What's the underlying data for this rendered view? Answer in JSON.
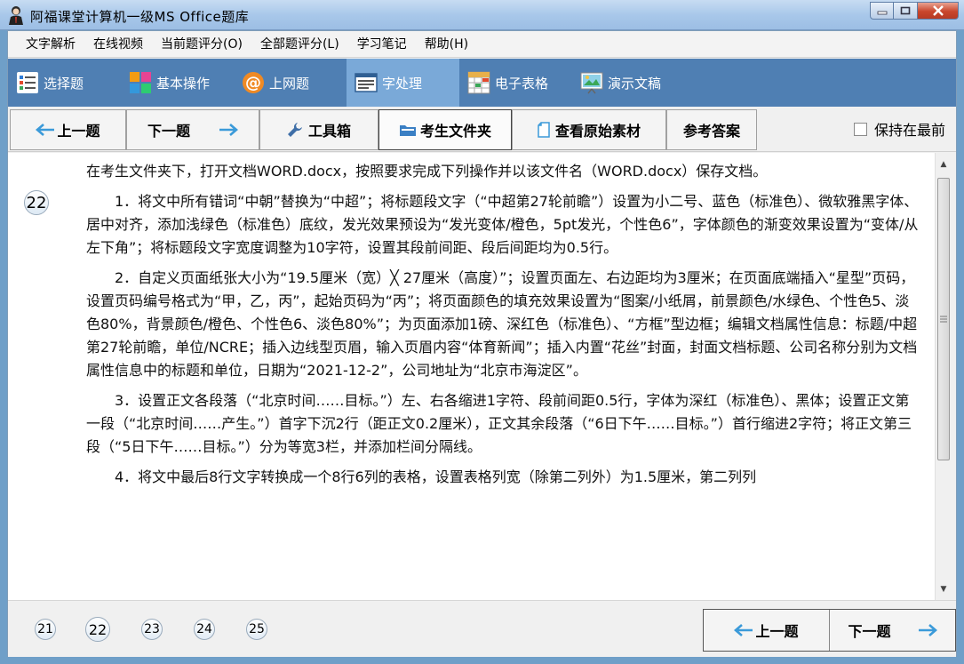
{
  "window": {
    "title": "阿福课堂计算机一级MS Office题库"
  },
  "menu": [
    "文字解析",
    "在线视频",
    "当前题评分(O)",
    "全部题评分(L)",
    "学习笔记",
    "帮助(H)"
  ],
  "categories": [
    {
      "label": "选择题",
      "icon": "list-icon"
    },
    {
      "label": "基本操作",
      "icon": "grid-icon"
    },
    {
      "label": "上网题",
      "icon": "at-sign-icon"
    },
    {
      "label": "字处理",
      "icon": "document-icon"
    },
    {
      "label": "电子表格",
      "icon": "spreadsheet-icon"
    },
    {
      "label": "演示文稿",
      "icon": "presentation-icon"
    }
  ],
  "toolbar": {
    "prev": "上一题",
    "next": "下一题",
    "tools": "工具箱",
    "folder": "考生文件夹",
    "source": "查看原始素材",
    "answer": "参考答案",
    "keep_on_top": "保持在最前"
  },
  "question": {
    "number": "22",
    "intro": "在考生文件夹下，打开文档WORD.docx，按照要求完成下列操作并以该文件名（WORD.docx）保存文档。",
    "p1": "1．将文中所有错词“中朝”替换为“中超”；将标题段文字（“中超第27轮前瞻”）设置为小二号、蓝色（标准色）、微软雅黑字体、居中对齐，添加浅绿色（标准色）底纹，发光效果预设为“发光变体/橙色，5pt发光，个性色6”，字体颜色的渐变效果设置为“变体/从左下角”；将标题段文字宽度调整为10字符，设置其段前间距、段后间距均为0.5行。",
    "p2": "2．自定义页面纸张大小为“19.5厘米（宽）╳ 27厘米（高度）”；设置页面左、右边距均为3厘米；在页面底端插入“星型”页码，设置页码编号格式为“甲，乙，丙”，起始页码为“丙”；将页面颜色的填充效果设置为“图案/小纸屑，前景颜色/水绿色、个性色5、淡色80%，背景颜色/橙色、个性色6、淡色80%”；为页面添加1磅、深红色（标准色）、“方框”型边框；编辑文档属性信息：标题/中超第27轮前瞻，单位/NCRE；插入边线型页眉，输入页眉内容“体育新闻”；插入内置“花丝”封面，封面文档标题、公司名称分别为文档属性信息中的标题和单位，日期为“2021-12-2”，公司地址为“北京市海淀区”。",
    "p3": "3．设置正文各段落（“北京时间……目标。”）左、右各缩进1字符、段前间距0.5行，字体为深红（标准色）、黑体；设置正文第一段（“北京时间……产生。”）首字下沉2行（距正文0.2厘米），正文其余段落（“6日下午……目标。”）首行缩进2字符；将正文第三段（“5日下午……目标。”）分为等宽3栏，并添加栏间分隔线。",
    "p4": "4．将文中最后8行文字转换成一个8行6列的表格，设置表格列宽（除第二列外）为1.5厘米，第二列列"
  },
  "pages": [
    "21",
    "22",
    "23",
    "24",
    "25"
  ],
  "bottom_nav": {
    "prev": "上一题",
    "next": "下一题"
  },
  "colors": {
    "category_bar": "#4f7fb3",
    "category_active": "#7aa9d8",
    "arrow": "#3b9ad9"
  }
}
